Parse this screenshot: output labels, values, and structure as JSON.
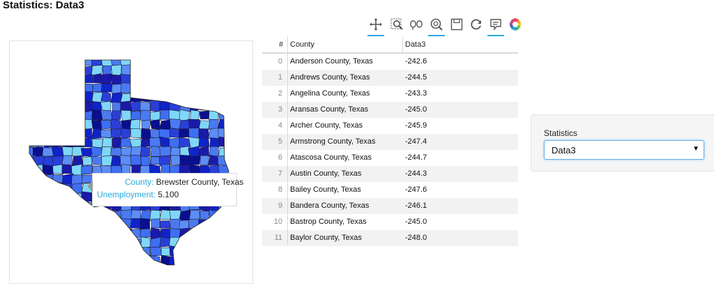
{
  "page": {
    "title": "Statistics: Data3"
  },
  "toolbar": {
    "tools": [
      {
        "name": "pan-tool",
        "icon": "pan-icon",
        "active": true
      },
      {
        "name": "box-zoom-tool",
        "icon": "box-zoom-icon",
        "active": false
      },
      {
        "name": "lasso-select-tool",
        "icon": "lasso-icon",
        "active": false
      },
      {
        "name": "wheel-zoom-tool",
        "icon": "wheel-zoom-icon",
        "active": true
      },
      {
        "name": "save-tool",
        "icon": "save-icon",
        "active": false
      },
      {
        "name": "reset-tool",
        "icon": "reset-icon",
        "active": false
      },
      {
        "name": "hover-tool",
        "icon": "hover-icon",
        "active": true
      },
      {
        "name": "bokeh-logo",
        "icon": "bokeh-logo-icon",
        "active": false
      }
    ],
    "accent_color": "#26aae1"
  },
  "map": {
    "colors": [
      "#1a1aa8",
      "#2a3fd8",
      "#3e6ef2",
      "#5c8ef5",
      "#7fd7f7",
      "#1023c8",
      "#0a0f8f",
      "#4b7af0"
    ],
    "tooltip": {
      "county_label": "County:",
      "county_value": "Brewster County, Texas",
      "unemployment_label": "Unemployment:",
      "unemployment_value": "5.100"
    }
  },
  "table": {
    "headers": {
      "index": "#",
      "county": "County",
      "data3": "Data3"
    },
    "rows": [
      {
        "index": "0",
        "county": "Anderson County, Texas",
        "data3": "-242.6"
      },
      {
        "index": "1",
        "county": "Andrews County, Texas",
        "data3": "-244.5"
      },
      {
        "index": "2",
        "county": "Angelina County, Texas",
        "data3": "-243.3"
      },
      {
        "index": "3",
        "county": "Aransas County, Texas",
        "data3": "-245.0"
      },
      {
        "index": "4",
        "county": "Archer County, Texas",
        "data3": "-245.9"
      },
      {
        "index": "5",
        "county": "Armstrong County, Texas",
        "data3": "-247.4"
      },
      {
        "index": "6",
        "county": "Atascosa County, Texas",
        "data3": "-244.7"
      },
      {
        "index": "7",
        "county": "Austin County, Texas",
        "data3": "-244.3"
      },
      {
        "index": "8",
        "county": "Bailey County, Texas",
        "data3": "-247.6"
      },
      {
        "index": "9",
        "county": "Bandera County, Texas",
        "data3": "-246.1"
      },
      {
        "index": "10",
        "county": "Bastrop County, Texas",
        "data3": "-245.0"
      },
      {
        "index": "11",
        "county": "Baylor County, Texas",
        "data3": "-248.0"
      }
    ]
  },
  "panel": {
    "label": "Statistics",
    "selected": "Data3"
  }
}
